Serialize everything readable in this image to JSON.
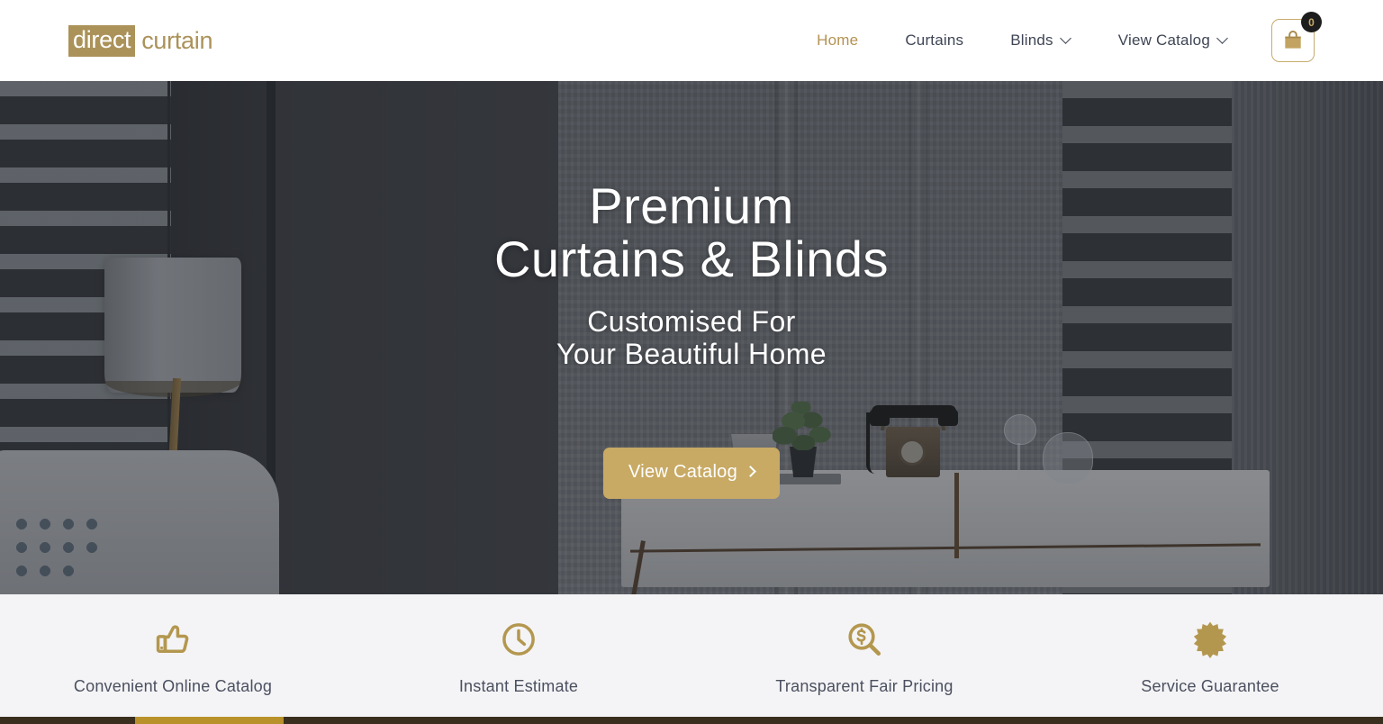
{
  "header": {
    "logo": {
      "mark": "direct",
      "word": "curtain",
      "name": "direct curtain"
    },
    "nav": [
      {
        "label": "Home",
        "active": true,
        "has_dropdown": false
      },
      {
        "label": "Curtains",
        "active": false,
        "has_dropdown": false
      },
      {
        "label": "Blinds",
        "active": false,
        "has_dropdown": true
      },
      {
        "label": "View Catalog",
        "active": false,
        "has_dropdown": true
      }
    ],
    "cart": {
      "icon": "shopping-bag-icon",
      "count": "0"
    }
  },
  "hero": {
    "title_line1": "Premium",
    "title_line2": "Curtains & Blinds",
    "subtitle_line1": "Customised For",
    "subtitle_line2": "Your Beautiful Home",
    "cta_label": "View Catalog"
  },
  "features": [
    {
      "icon": "thumbs-up-icon",
      "label": "Convenient Online Catalog"
    },
    {
      "icon": "clock-icon",
      "label": "Instant Estimate"
    },
    {
      "icon": "magnifier-dollar-icon",
      "label": "Transparent Fair Pricing"
    },
    {
      "icon": "starburst-badge-icon",
      "label": "Service Guarantee"
    }
  ],
  "colors": {
    "brand_gold": "#ab9259",
    "cta_gold": "#c8aa65",
    "icon_gold": "#b4974f",
    "nav_text": "#3f4555",
    "feature_text": "#4b5060",
    "features_bg": "#f4f4f6",
    "bottom_bar": "#3a2f1e",
    "bottom_bar_fill": "#b8912a"
  }
}
